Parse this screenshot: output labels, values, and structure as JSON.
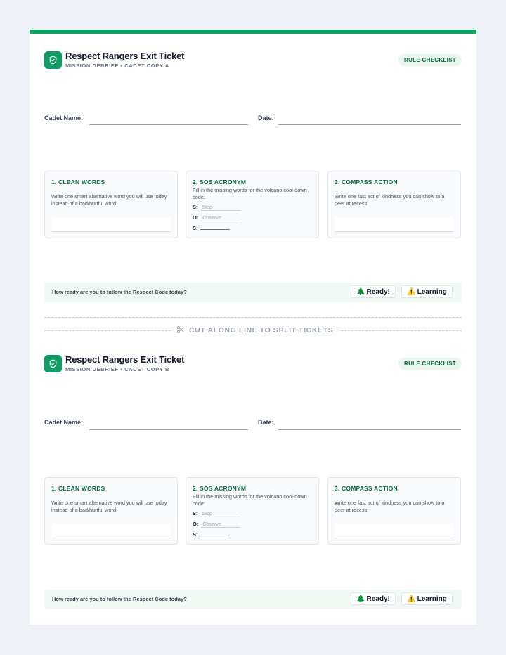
{
  "ticket_a": {
    "title": "Respect Rangers Exit Ticket",
    "subtitle": "MISSION DEBRIEF • CADET COPY A",
    "badge": "RULE CHECKLIST",
    "name_label": "Cadet Name:",
    "date_label": "Date:",
    "cards": [
      {
        "title": "1. CLEAN WORDS",
        "desc": "Write one smart alternative word you will use today instead of a bad/hurtful word:"
      },
      {
        "title": "2. SOS ACRONYM",
        "desc": "Fill in the missing words for the volcano cool-down code:",
        "rows": [
          {
            "letter": "S:",
            "value": "Stop"
          },
          {
            "letter": "O:",
            "value": "Observe"
          },
          {
            "letter": "S:",
            "value": ""
          }
        ]
      },
      {
        "title": "3. COMPASS ACTION",
        "desc": "Write one fast act of kindness you can show to a peer at recess:"
      }
    ],
    "ready_question": "How ready are you to follow the Respect Code today?",
    "ready_label": "Ready!",
    "learning_label": "Learning"
  },
  "cut_line": {
    "label": "CUT ALONG LINE TO SPLIT TICKETS"
  },
  "ticket_b": {
    "title": "Respect Rangers Exit Ticket",
    "subtitle": "MISSION DEBRIEF • CADET COPY B",
    "badge": "RULE CHECKLIST",
    "name_label": "Cadet Name:",
    "date_label": "Date:",
    "cards": [
      {
        "title": "1. CLEAN WORDS",
        "desc": "Write one smart alternative word you will use today instead of a bad/hurtful word:"
      },
      {
        "title": "2. SOS ACRONYM",
        "desc": "Fill in the missing words for the volcano cool-down code:",
        "rows": [
          {
            "letter": "S:",
            "value": "Stop"
          },
          {
            "letter": "O:",
            "value": "Observe"
          },
          {
            "letter": "S:",
            "value": ""
          }
        ]
      },
      {
        "title": "3. COMPASS ACTION",
        "desc": "Write one fast act of kindness you can show to a peer at recess:"
      }
    ],
    "ready_question": "How ready are you to follow the Respect Code today?",
    "ready_label": "Ready!",
    "learning_label": "Learning"
  },
  "colors": {
    "accent": "#0f9d63",
    "badge_text": "#0b6b3f"
  },
  "icons": {
    "brand": "shield-check-icon",
    "ready": "evergreen-tree-icon",
    "learning": "warning-icon",
    "cut": "scissors-icon"
  }
}
